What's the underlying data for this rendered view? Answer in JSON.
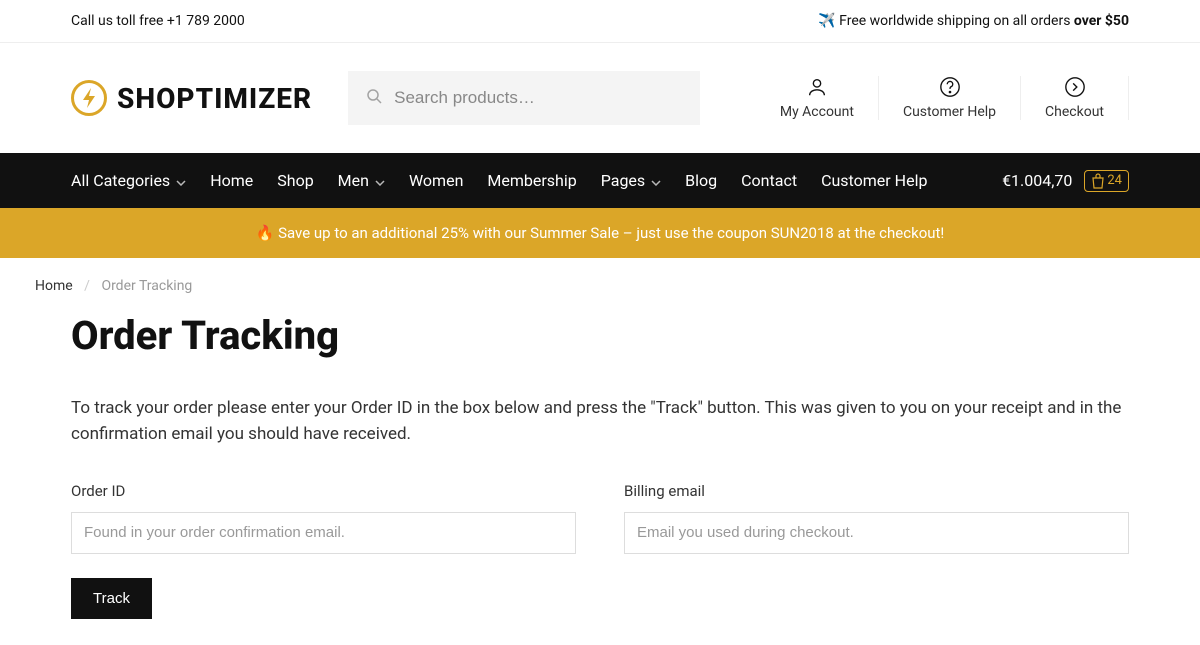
{
  "topbar": {
    "left": "Call us toll free +1 789 2000",
    "right_prefix": "✈️ Free worldwide shipping on all orders ",
    "right_bold": "over $50"
  },
  "logo": {
    "text": "SHOPTIMIZER"
  },
  "search": {
    "placeholder": "Search products…"
  },
  "quicklinks": [
    {
      "label": "My Account",
      "icon": "user-icon"
    },
    {
      "label": "Customer Help",
      "icon": "help-icon"
    },
    {
      "label": "Checkout",
      "icon": "checkout-icon"
    }
  ],
  "nav": {
    "items": [
      {
        "label": "All Categories",
        "dropdown": true
      },
      {
        "label": "Home",
        "dropdown": false
      },
      {
        "label": "Shop",
        "dropdown": false
      },
      {
        "label": "Men",
        "dropdown": true
      },
      {
        "label": "Women",
        "dropdown": false
      },
      {
        "label": "Membership",
        "dropdown": false
      },
      {
        "label": "Pages",
        "dropdown": true
      },
      {
        "label": "Blog",
        "dropdown": false
      },
      {
        "label": "Contact",
        "dropdown": false
      },
      {
        "label": "Customer Help",
        "dropdown": false
      }
    ]
  },
  "cart": {
    "total": "€1.004,70",
    "count": "24"
  },
  "promo": {
    "text": "🔥 Save up to an additional 25% with our Summer Sale – just use the coupon SUN2018 at the checkout!"
  },
  "breadcrumb": {
    "home": "Home",
    "current": "Order Tracking"
  },
  "page": {
    "title": "Order Tracking",
    "instructions": "To track your order please enter your Order ID in the box below and press the \"Track\" button. This was given to you on your receipt and in the confirmation email you should have received."
  },
  "form": {
    "order_id_label": "Order ID",
    "order_id_placeholder": "Found in your order confirmation email.",
    "billing_email_label": "Billing email",
    "billing_email_placeholder": "Email you used during checkout.",
    "submit_label": "Track"
  }
}
